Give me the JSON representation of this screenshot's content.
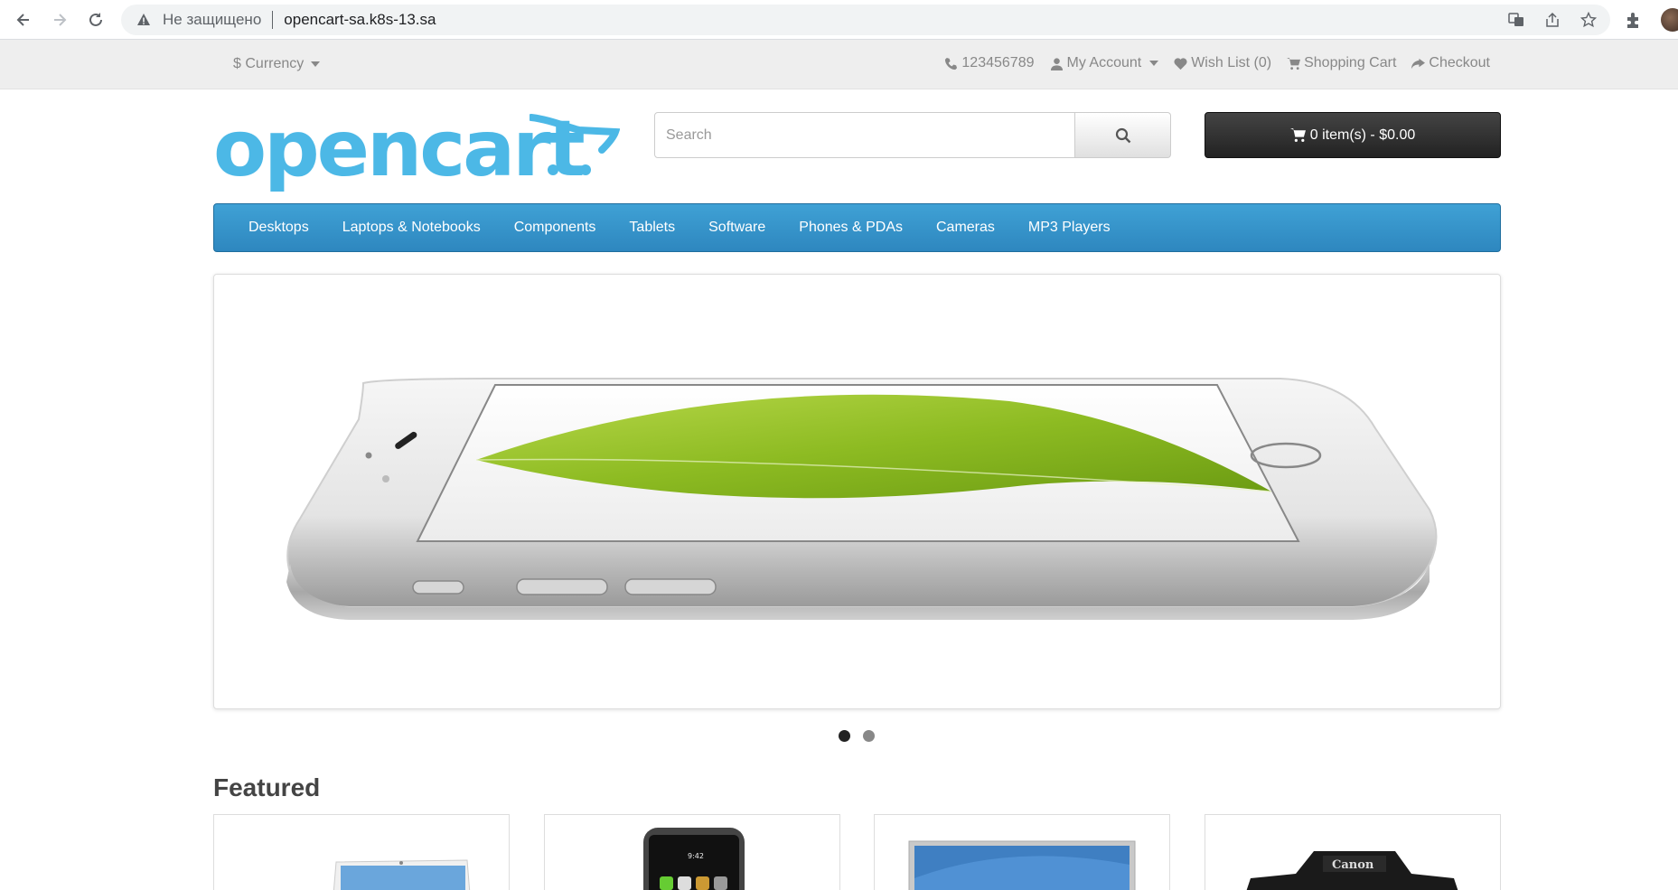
{
  "browser": {
    "insecure_label": "Не защищено",
    "url": "opencart-sa.k8s-13.sa",
    "icons": [
      "back-icon",
      "forward-icon",
      "reload-icon",
      "warning-icon",
      "translate-icon",
      "share-icon",
      "star-icon",
      "extensions-icon"
    ]
  },
  "topbar": {
    "currency_label": "Currency",
    "currency_symbol": "$",
    "phone": "123456789",
    "my_account": "My Account",
    "wishlist": "Wish List (0)",
    "shopping_cart": "Shopping Cart",
    "checkout": "Checkout"
  },
  "header": {
    "logo_text": "opencart",
    "search_placeholder": "Search",
    "cart_label": "0 item(s) - $0.00"
  },
  "menu": {
    "items": [
      "Desktops",
      "Laptops & Notebooks",
      "Components",
      "Tablets",
      "Software",
      "Phones & PDAs",
      "Cameras",
      "MP3 Players"
    ]
  },
  "slideshow": {
    "slide_count": 2,
    "active_index": 0
  },
  "featured": {
    "title": "Featured",
    "products": [
      "laptop",
      "iphone",
      "monitor",
      "canon-camera"
    ]
  },
  "colors": {
    "brand_blue": "#4cb8e6",
    "menu_blue": "#3a9bd1",
    "cart_dark": "#333333"
  }
}
